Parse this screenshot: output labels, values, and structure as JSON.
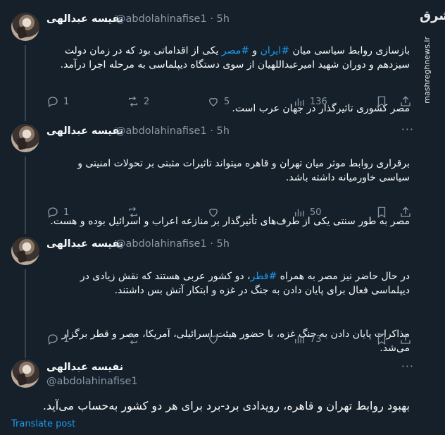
{
  "watermark": {
    "logo": "مشرق",
    "url": "mashreghnews.ir"
  },
  "tweets": [
    {
      "name": "نفیسه عبدالهی",
      "handle": "@abdolahinafise1",
      "time": "5h",
      "p1_before": "بازسازی روابط سیاسی میان ",
      "p1_tag1": "#ایران",
      "p1_mid": " و ",
      "p1_tag2": "#مصر",
      "p1_after": " یکی از اقداماتی بود که در زمان دولت سیزدهم و دوران شهید امیرعبداللهیان از سوی دستگاه دیپلماسی به مرحله اجرا درآمد.",
      "p2": "مصر کشوری تاثیرگذار در جهان عرب است.",
      "replies": "1",
      "reposts": "2",
      "likes": "5",
      "views": "136"
    },
    {
      "name": "نفیسه عبدالهی",
      "handle": "@abdolahinafise1",
      "time": "5h",
      "p1": "برقراری روابط موثر  میان تهران و قاهره میتواند تاثیرات مثبتی بر تحولات امنیتی و سیاسی خاورمیانه داشته باشد.",
      "p2": "مصر به طور سنتی یکی از طرف‌های تأثیرگذار بر منازعه اعراب و اسرائیل بوده و هست.",
      "replies": "1",
      "views": "50"
    },
    {
      "name": "نفیسه عبدالهی",
      "handle": "@abdolahinafise1",
      "time": "5h",
      "p1_before": "در حال حاضر نیز مصر به همراه ",
      "p1_tag": "#قطر",
      "p1_after": "، دو کشور عربی هستند که نقش زیادی در دیپلماسی فعال برای پایان دادن به جنگ در غزه و ابتکار آتش بس داشتند.",
      "p2": "مذاکرات پایان دادن به جنگ غزه، با حضور هیئت اسرائیلی، آمریکا، مصر و قطر برگزار می‌شد.",
      "replies": "1",
      "views": "73"
    }
  ],
  "main_tweet": {
    "name": "نفیسه عبدالهی",
    "handle": "@abdolahinafise1",
    "text": "بهبود روابط تهران و قاهره، رویدادی برد-برد برای هر دو کشور به‌حساب می‌آید.",
    "translate": "Translate post"
  },
  "icons": [
    "reply-icon",
    "repost-icon",
    "like-icon",
    "views-icon",
    "bookmark-icon",
    "share-icon",
    "more-icon"
  ]
}
